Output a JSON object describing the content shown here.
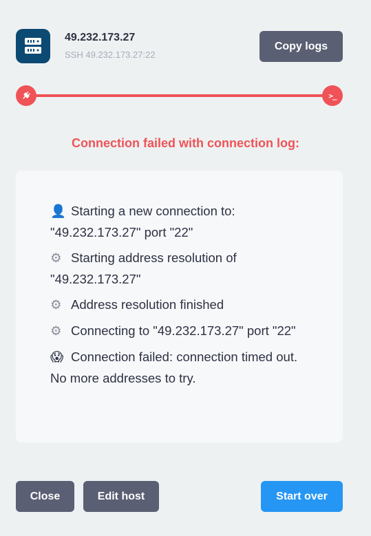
{
  "host": {
    "name": "49.232.173.27",
    "subtitle": "SSH 49.232.173.27:22",
    "icon": "server-icon"
  },
  "buttons": {
    "copy_logs": "Copy logs",
    "close": "Close",
    "edit_host": "Edit host",
    "start_over": "Start over"
  },
  "progress": {
    "start_icon": "plug-icon",
    "end_icon": "terminal-icon",
    "end_glyph": ">_",
    "status_color": "#ef5357"
  },
  "status_title": "Connection failed with connection log:",
  "logs": [
    {
      "icon": "person-icon",
      "glyph": "👤",
      "text": "Starting a new connection to: \"49.232.173.27\" port \"22\""
    },
    {
      "icon": "gear-icon",
      "glyph": "⚙",
      "text": "Starting address resolution of \"49.232.173.27\""
    },
    {
      "icon": "gear-icon",
      "glyph": "⚙",
      "text": "Address resolution finished"
    },
    {
      "icon": "gear-icon",
      "glyph": "⚙",
      "text": "Connecting to \"49.232.173.27\" port \"22\""
    },
    {
      "icon": "scared-face-icon",
      "glyph": "😱",
      "text": "Connection failed: connection timed out. No more addresses to try."
    }
  ],
  "colors": {
    "background": "#eef1f2",
    "accent_red": "#ef5357",
    "primary_blue": "#2596f4",
    "button_dark": "#5a5f73",
    "host_icon_bg": "#0c4a73"
  }
}
